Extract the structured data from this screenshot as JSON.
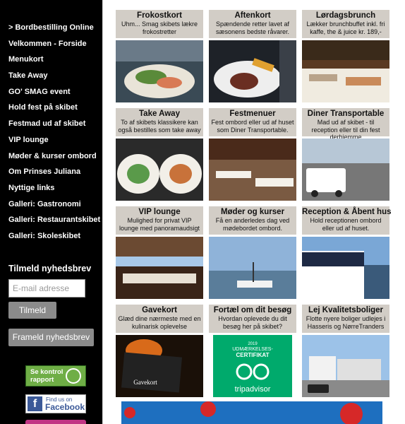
{
  "nav": {
    "items": [
      {
        "label": "Bordbestilling Online",
        "active": true
      },
      {
        "label": "Velkommen - Forside"
      },
      {
        "label": "Menukort"
      },
      {
        "label": "Take Away"
      },
      {
        "label": "GO' SMAG event"
      },
      {
        "label": "Hold fest på skibet"
      },
      {
        "label": "Festmad ud af skibet"
      },
      {
        "label": "VIP lounge"
      },
      {
        "label": "Møder & kurser ombord"
      },
      {
        "label": "Om Prinses Juliana"
      },
      {
        "label": "Nyttige links"
      },
      {
        "label": "Galleri: Gastronomi"
      },
      {
        "label": "Galleri: Restaurantskibet"
      },
      {
        "label": "Galleri: Skoleskibet"
      }
    ]
  },
  "newsletter": {
    "heading": "Tilmeld nyhedsbrev",
    "email_placeholder": "E-mail adresse",
    "subscribe_label": "Tilmeld",
    "unsubscribe_label": "Frameld nyhedsbrev"
  },
  "badges": {
    "kontrol_line1": "Se kontrol",
    "kontrol_line2": "rapport",
    "fb_line1": "Find us on",
    "fb_line2": "Facebook"
  },
  "tiles": [
    {
      "title": "Frokostkort",
      "desc": "Uhm... Smag skibets lækre frokostretter",
      "img": "food-plate",
      "colors": [
        "#3a4a55",
        "#e9e4d8",
        "#d87a55"
      ]
    },
    {
      "title": "Aftenkort",
      "desc": "Spændende retter lavet af sæsonens bedste råvarer.",
      "img": "steak-plate",
      "colors": [
        "#1e2228",
        "#eeeeee",
        "#6a2e22"
      ]
    },
    {
      "title": "Lørdagsbrunch",
      "desc": "Lækker brunchbuffet inkl. fri kaffe, the & juice kr. 189,-",
      "img": "buffet",
      "colors": [
        "#5a3a22",
        "#f0ebe0",
        "#b9a38a"
      ]
    },
    {
      "title": "Take Away",
      "desc": "To af skibets klassikere kan også bestilles som take away",
      "img": "takeaway",
      "colors": [
        "#2a2a2a",
        "#f2efe8",
        "#c8723a"
      ]
    },
    {
      "title": "Festmenuer",
      "desc": "Fest ombord eller ud af huset som Diner Transportable.",
      "img": "dining-room",
      "colors": [
        "#4a2a1a",
        "#f4f1ea",
        "#8a5a3a"
      ]
    },
    {
      "title": "Diner Transportable",
      "desc": "Mad ud af skibet - til reception eller til din fest derhjemme",
      "img": "van",
      "colors": [
        "#8a9aa8",
        "#ffffff",
        "#6a6a6a"
      ]
    },
    {
      "title": "VIP lounge",
      "desc": "Mulighed for privat VIP lounge med panoramaudsigt",
      "img": "lounge",
      "colors": [
        "#3a2418",
        "#e8e0d4",
        "#6b4a32"
      ]
    },
    {
      "title": "Møder og kurser",
      "desc": "Få en anderledes dag ved mødebordet ombord.",
      "img": "harbor",
      "colors": [
        "#8fb3d9",
        "#5a7d9a",
        "#f2f2f2"
      ]
    },
    {
      "title": "Reception & Åbent hus",
      "desc": "Hold receptionen ombord eller ud af huset.",
      "img": "ship-side",
      "colors": [
        "#7aa7d6",
        "#1e2a44",
        "#ffffff"
      ]
    },
    {
      "title": "Gavekort",
      "desc": "Glæd dine nærmeste med en kulinarisk oplevelse",
      "img": "gift-card",
      "colors": [
        "#1a1008",
        "#d86a1a",
        "#222222"
      ],
      "caption": "Gavekort"
    },
    {
      "title": "Fortæl om dit besøg",
      "desc": "Hvordan oplevede du dit besøg her på skibet?",
      "img": "tripadvisor",
      "colors": [
        "#00aa6c",
        "#ffffff",
        "#000000"
      ],
      "caption_line1": "2019",
      "caption_line2": "UDMÆRKELSES-",
      "caption_line3": "CERTIFIKAT",
      "caption_line4": "tripadvisor"
    },
    {
      "title": "Lej Kvalitetsboliger",
      "desc": "Flotte nyere boliger udlejes i Hasseris og NørreTranders",
      "img": "houses",
      "colors": [
        "#9cc2e8",
        "#f2f2f2",
        "#4a6a3a"
      ]
    }
  ],
  "banner": {
    "color": "#1e6fbf",
    "virus_color": "#d62828"
  }
}
